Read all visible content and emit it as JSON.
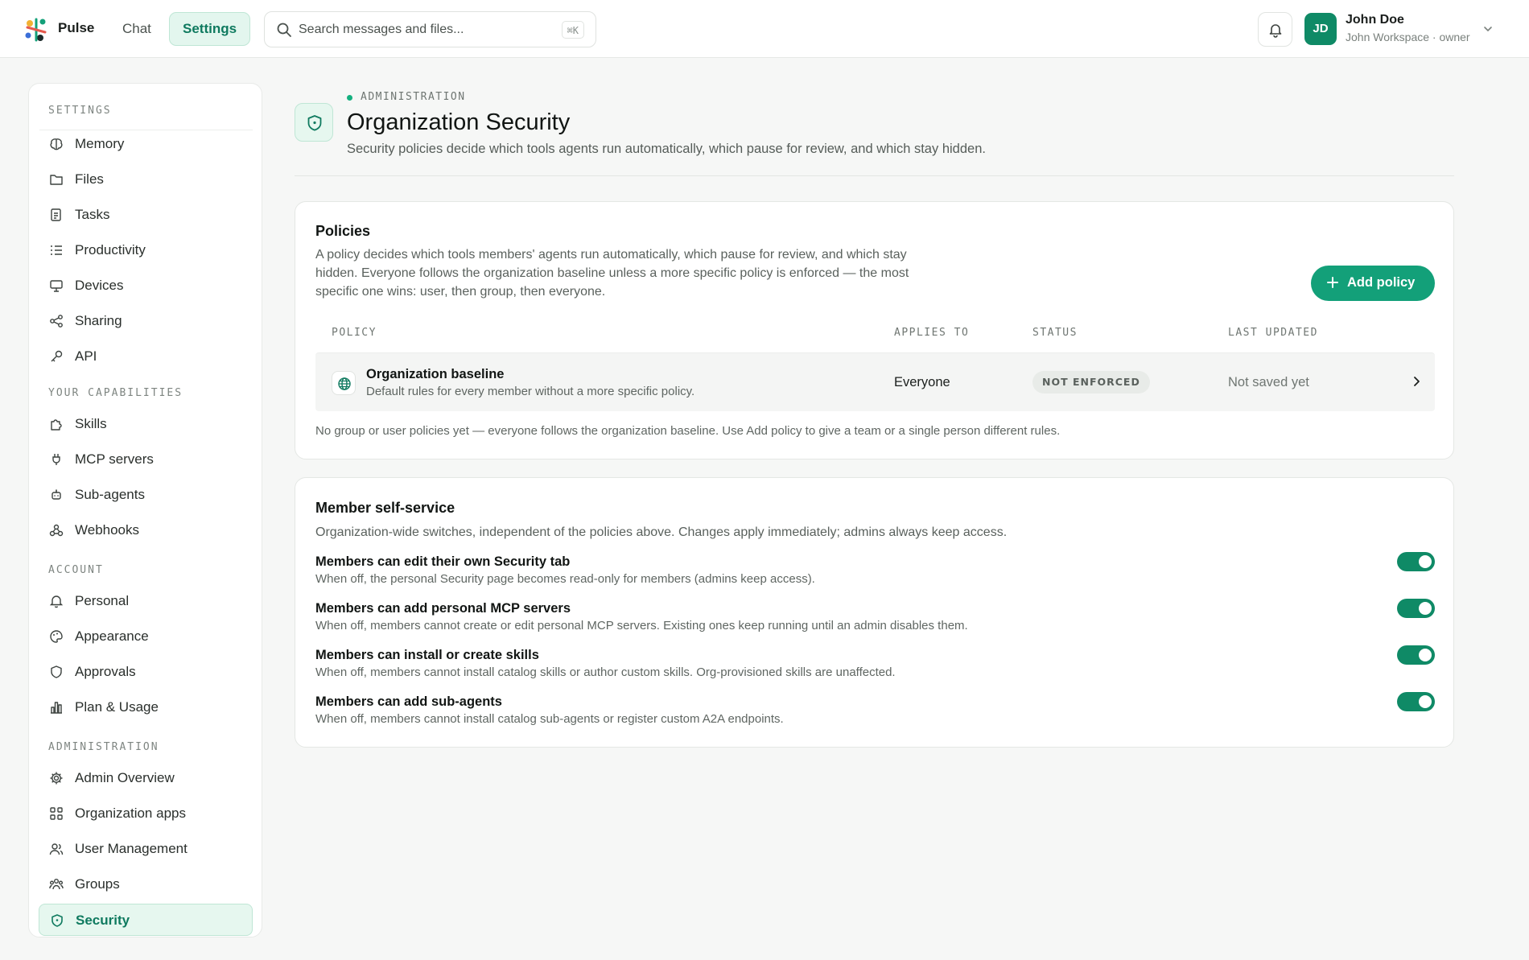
{
  "topbar": {
    "brand": "Pulse",
    "nav": {
      "chat": "Chat",
      "settings": "Settings"
    },
    "search": {
      "placeholder": "Search messages and files...",
      "shortcut": "⌘K"
    },
    "user": {
      "initials": "JD",
      "name": "John Doe",
      "subtitle": "John Workspace · owner"
    },
    "colors": {
      "accent": "#13a079",
      "accent_dark": "#0f8a66",
      "accent_tint": "#e3f6ee"
    }
  },
  "sidebar": {
    "sections": [
      {
        "label": "SETTINGS",
        "items": [
          {
            "label": "Memory",
            "icon": "brain-icon"
          },
          {
            "label": "Files",
            "icon": "folder-icon"
          },
          {
            "label": "Tasks",
            "icon": "clipboard-icon"
          },
          {
            "label": "Productivity",
            "icon": "list-icon"
          },
          {
            "label": "Devices",
            "icon": "monitor-icon"
          },
          {
            "label": "Sharing",
            "icon": "share-icon"
          },
          {
            "label": "API",
            "icon": "key-icon"
          }
        ]
      },
      {
        "label": "YOUR CAPABILITIES",
        "items": [
          {
            "label": "Skills",
            "icon": "puzzle-icon"
          },
          {
            "label": "MCP servers",
            "icon": "plug-icon"
          },
          {
            "label": "Sub-agents",
            "icon": "bot-icon"
          },
          {
            "label": "Webhooks",
            "icon": "webhook-icon"
          }
        ]
      },
      {
        "label": "ACCOUNT",
        "items": [
          {
            "label": "Personal",
            "icon": "bell-icon"
          },
          {
            "label": "Appearance",
            "icon": "palette-icon"
          },
          {
            "label": "Approvals",
            "icon": "shield-icon"
          },
          {
            "label": "Plan & Usage",
            "icon": "bar-chart-icon"
          }
        ]
      },
      {
        "label": "ADMINISTRATION",
        "items": [
          {
            "label": "Admin Overview",
            "icon": "gear-icon"
          },
          {
            "label": "Organization apps",
            "icon": "grid-icon"
          },
          {
            "label": "User Management",
            "icon": "users-icon"
          },
          {
            "label": "Groups",
            "icon": "group-icon"
          },
          {
            "label": "Security",
            "icon": "shield-check-icon",
            "active": true
          }
        ]
      }
    ]
  },
  "page": {
    "eyebrow": "ADMINISTRATION",
    "title": "Organization Security",
    "subtitle": "Security policies decide which tools agents run automatically, which pause for review, and which stay hidden."
  },
  "policies": {
    "title": "Policies",
    "description_lines": [
      "A policy decides which tools members' agents run automatically, which pause for review, and which stay",
      "hidden. Everyone follows the organization baseline unless a more specific policy is enforced — the most",
      "specific one wins: user, then group, then everyone."
    ],
    "add_button": "Add policy",
    "columns": [
      "POLICY",
      "APPLIES TO",
      "STATUS",
      "LAST UPDATED"
    ],
    "rows": [
      {
        "name": "Organization baseline",
        "description": "Default rules for every member without a more specific policy.",
        "applies_to": "Everyone",
        "status": "NOT ENFORCED",
        "last_updated": "Not saved yet"
      }
    ],
    "note": "No group or user policies yet — everyone follows the organization baseline. Use Add policy to give a team or a single person different rules."
  },
  "self_service": {
    "title": "Member self-service",
    "description": "Organization-wide switches, independent of the policies above. Changes apply immediately; admins always keep access.",
    "options": [
      {
        "title": "Members can edit their own Security tab",
        "description": "When off, the personal Security page becomes read-only for members (admins keep access).",
        "enabled": true
      },
      {
        "title": "Members can add personal MCP servers",
        "description": "When off, members cannot create or edit personal MCP servers. Existing ones keep running until an admin disables them.",
        "enabled": true
      },
      {
        "title": "Members can install or create skills",
        "description": "When off, members cannot install catalog skills or author custom skills. Org-provisioned skills are unaffected.",
        "enabled": true
      },
      {
        "title": "Members can add sub-agents",
        "description": "When off, members cannot install catalog sub-agents or register custom A2A endpoints.",
        "enabled": true
      }
    ]
  }
}
